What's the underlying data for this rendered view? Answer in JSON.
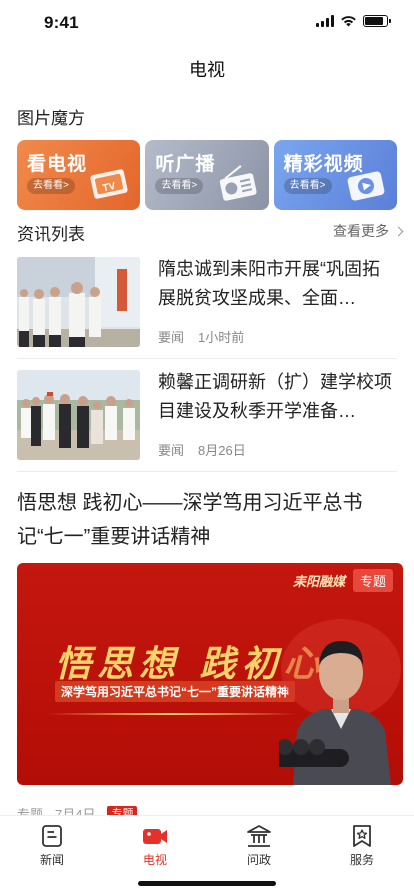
{
  "status_bar": {
    "time": "9:41",
    "battery_level": 0.85
  },
  "header": {
    "title": "电视"
  },
  "magic_cube": {
    "title": "图片魔方",
    "cards": [
      {
        "title": "看电视",
        "pill": "去看看>",
        "icon": "tv-icon",
        "color": "#e96f35"
      },
      {
        "title": "听广播",
        "pill": "去看看>",
        "icon": "radio-icon",
        "color": "#9aa1b2"
      },
      {
        "title": "精彩视频",
        "pill": "去看看>",
        "icon": "video-icon",
        "color": "#6b91e4"
      }
    ]
  },
  "news_list": {
    "title": "资讯列表",
    "see_more": "查看更多",
    "items": [
      {
        "title": "隋忠诚到耒阳市开展“巩固拓展脱贫攻坚成果、全面…",
        "category": "要闻",
        "time": "1小时前"
      },
      {
        "title": "赖馨正调研新（扩）建学校项目建设及秋季开学准备…",
        "category": "要闻",
        "time": "8月26日"
      }
    ]
  },
  "feature": {
    "title": "悟思想 践初心——深学笃用习近平总书记“七一”重要讲话精神",
    "banner": {
      "brand": "耒阳融媒",
      "tag": "专题",
      "slogan": "悟思想 践初心",
      "subtitle": "深学笃用习近平总书记“七一”重要讲话精神"
    },
    "category": "专题",
    "date": "7月4日",
    "badge": "专题"
  },
  "tab_bar": {
    "accent_color": "#e4322a",
    "tabs": [
      {
        "label": "新闻",
        "icon": "news-icon",
        "active": false
      },
      {
        "label": "电视",
        "icon": "tv-camera-icon",
        "active": true
      },
      {
        "label": "问政",
        "icon": "government-icon",
        "active": false
      },
      {
        "label": "服务",
        "icon": "service-star-icon",
        "active": false
      }
    ]
  }
}
